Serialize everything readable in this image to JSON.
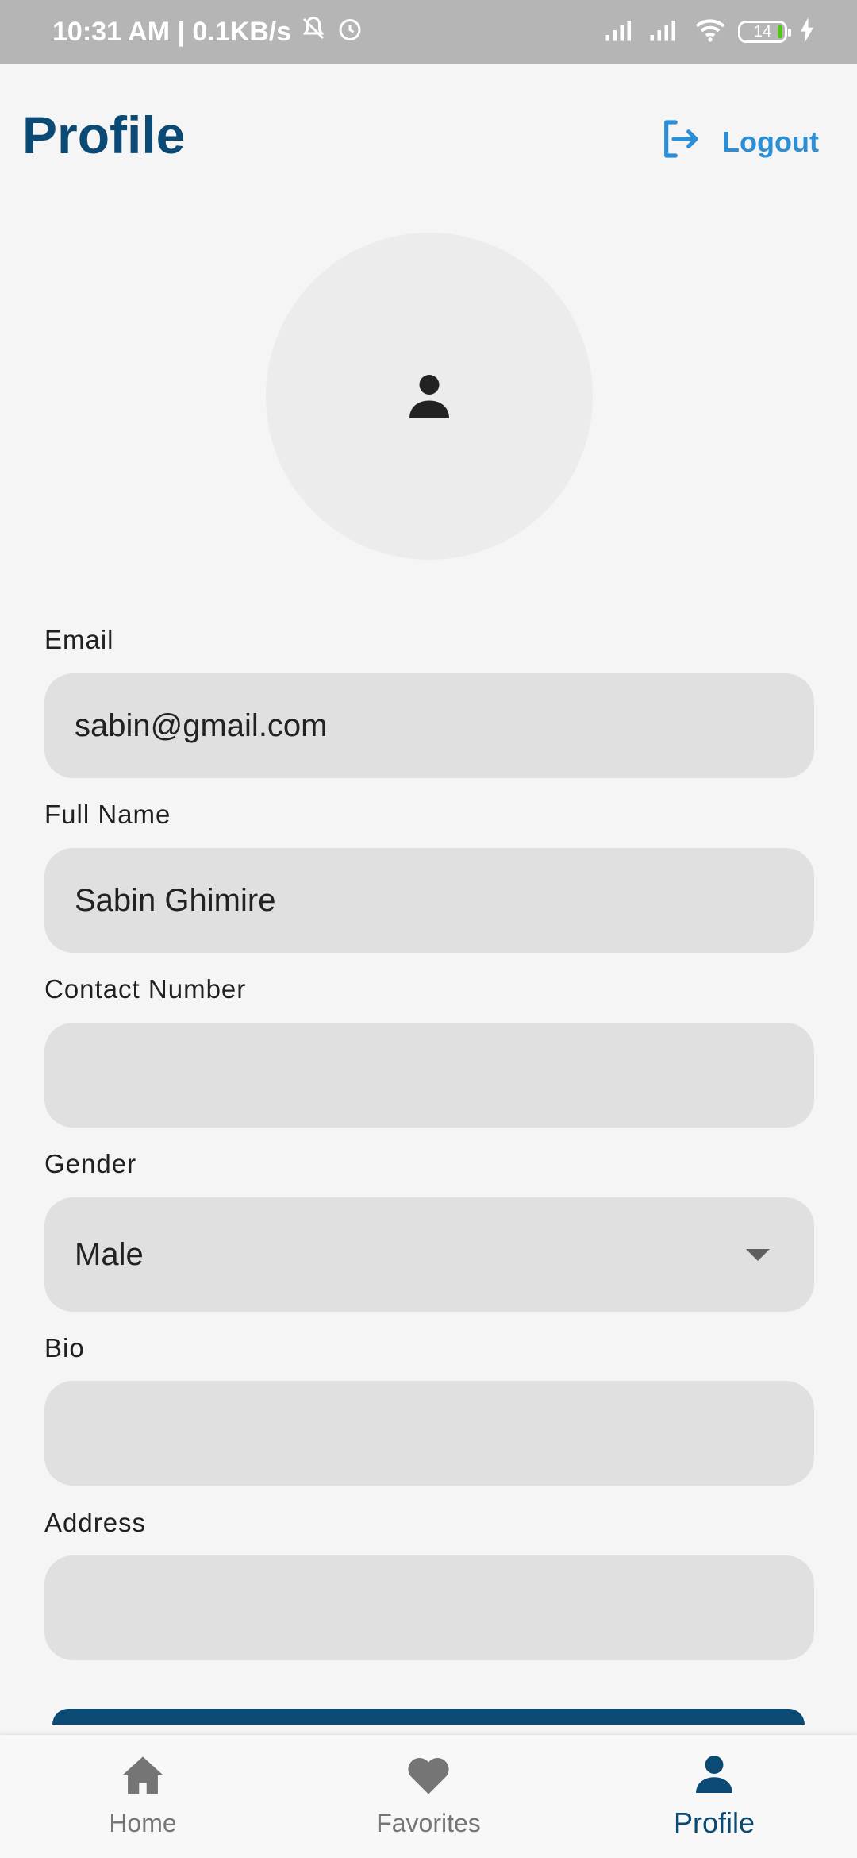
{
  "status_bar": {
    "time_network": "10:31 AM | 0.1KB/s",
    "battery_level": "14",
    "icons": [
      "mute-icon",
      "alarm-icon",
      "signal-icon",
      "signal-icon",
      "wifi-icon",
      "battery-icon",
      "charging-icon"
    ]
  },
  "header": {
    "title": "Profile",
    "logout_label": "Logout",
    "logout_icon": "logout-icon"
  },
  "avatar": {
    "icon": "person-icon"
  },
  "form": {
    "email": {
      "label": "Email",
      "value": "sabin@gmail.com"
    },
    "full_name": {
      "label": "Full Name",
      "value": "Sabin Ghimire"
    },
    "contact_number": {
      "label": "Contact Number",
      "value": ""
    },
    "gender": {
      "label": "Gender",
      "value": "Male"
    },
    "bio": {
      "label": "Bio",
      "value": ""
    },
    "address": {
      "label": "Address",
      "value": ""
    }
  },
  "bottom_nav": {
    "items": [
      {
        "label": "Home",
        "icon": "home-icon",
        "active": false
      },
      {
        "label": "Favorites",
        "icon": "heart-icon",
        "active": false
      },
      {
        "label": "Profile",
        "icon": "person-icon",
        "active": true
      }
    ]
  },
  "colors": {
    "primary": "#0b4a75",
    "accent": "#2b8fd8",
    "field_bg": "#e0e0e0",
    "page_bg": "#f5f5f5",
    "status_bar_bg": "#b5b5b5"
  }
}
